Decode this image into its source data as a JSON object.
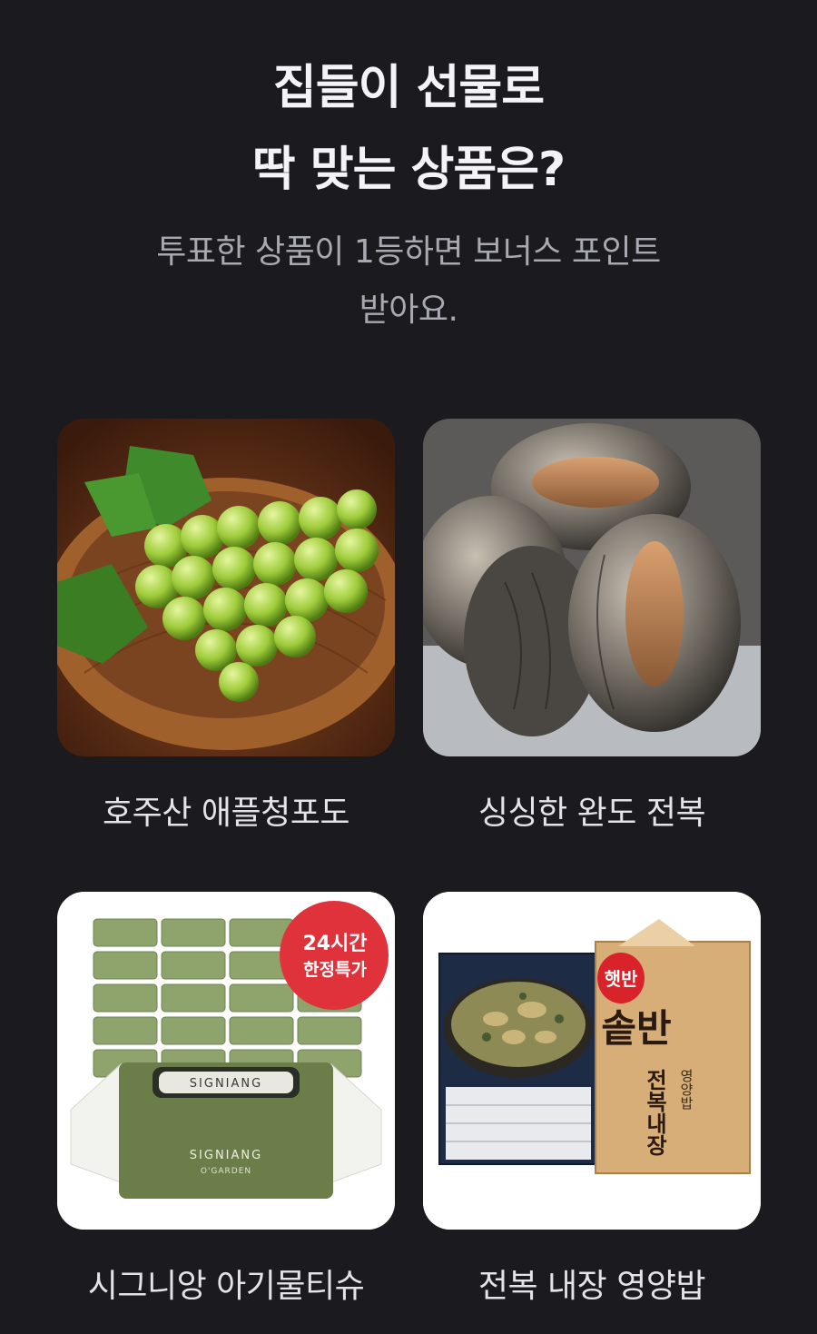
{
  "header": {
    "title_line1": "집들이 선물로",
    "title_line2": "딱 맞는 상품은?",
    "subtitle_line1": "투표한 상품이 1등하면 보너스 포인트",
    "subtitle_line2": "받아요."
  },
  "products": [
    {
      "name": "호주산 애플청포도"
    },
    {
      "name": "싱싱한 완도 전복"
    },
    {
      "name": "시그니앙 아기물티슈",
      "badge_line1": "24시간",
      "badge_line2": "한정특가",
      "brand": "SIGNIANG",
      "sub_brand": "O'GARDEN"
    },
    {
      "name": "전복 내장 영양밥",
      "brand_badge": "햇반",
      "brand": "솥반",
      "product_line": "전복내장",
      "product_tag": "영양밥"
    }
  ],
  "colors": {
    "background": "#1b1a1f",
    "title": "#f4f4f6",
    "subtitle": "#a9a9b1",
    "label": "#e4e4e8",
    "badge": "#e0323a"
  }
}
